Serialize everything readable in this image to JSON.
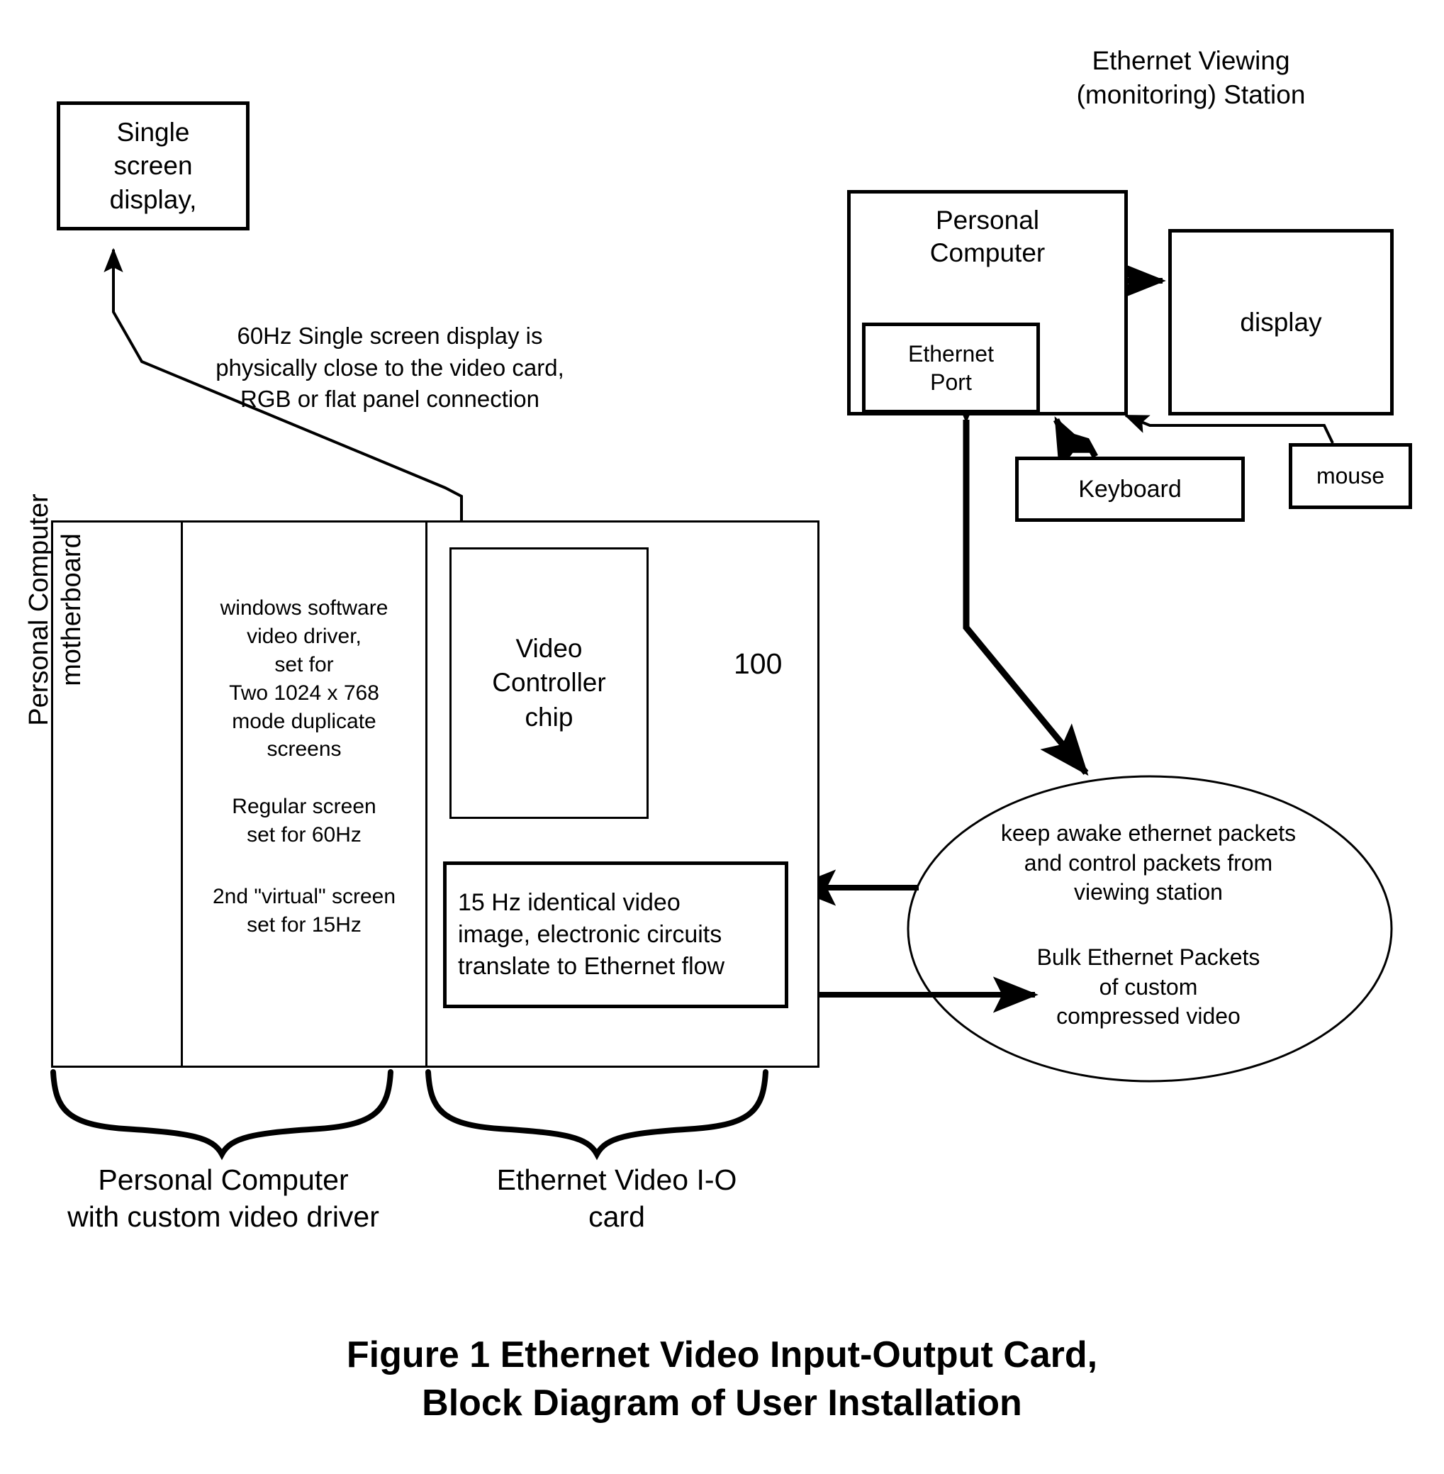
{
  "figure": {
    "caption_line1": "Figure 1 Ethernet Video Input-Output Card,",
    "caption_line2": "Block Diagram of User Installation",
    "caption": "Figure 1 Ethernet Video Input-Output Card,\nBlock Diagram of User Installation"
  },
  "single_screen_display": {
    "label": "Single\nscreen\ndisplay,"
  },
  "notes": {
    "display_connection": "60Hz Single screen display is\nphysically close to the video card,\nRGB or flat panel connection"
  },
  "viewing_station": {
    "title": "Ethernet Viewing\n(monitoring) Station",
    "personal_computer": "Personal\nComputer",
    "ethernet_port": "Ethernet\nPort",
    "display": "display",
    "keyboard": "Keyboard",
    "mouse": "mouse"
  },
  "computer": {
    "motherboard_label": "Personal Computer\nmotherboard",
    "driver_text": "windows software\nvideo driver,\nset for\nTwo 1024 x 768\nmode duplicate\nscreens",
    "regular_screen_text": "Regular screen\nset for 60Hz",
    "virtual_screen_text": "2nd \"virtual\" screen\nset for 15Hz",
    "video_controller": "Video\nController\nchip",
    "reference_numeral": "100",
    "ethernet_flow_box": "15 Hz identical video\nimage, electronic circuits\ntranslate to Ethernet flow"
  },
  "network_cloud": {
    "keep_awake_text": "keep awake ethernet packets\nand control packets from\nviewing station",
    "bulk_packets_text": "Bulk Ethernet Packets\nof custom\ncompressed video"
  },
  "brace_labels": {
    "left": "Personal Computer\nwith custom video driver",
    "right": "Ethernet Video I-O\ncard"
  },
  "colors": {
    "ink": "#000000",
    "paper": "#ffffff"
  }
}
